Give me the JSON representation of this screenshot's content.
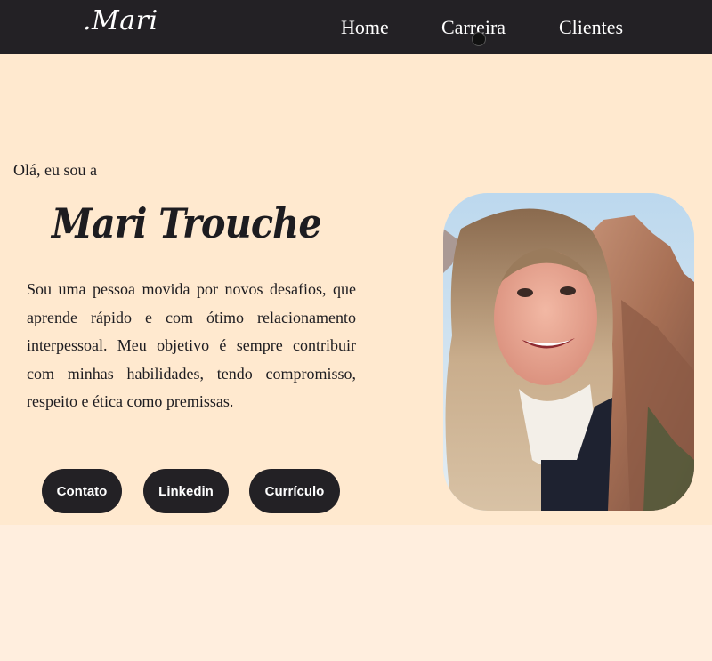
{
  "header": {
    "logo": ".Mari",
    "nav": [
      {
        "label": "Home"
      },
      {
        "label": "Carreira"
      },
      {
        "label": "Clientes"
      }
    ]
  },
  "hero": {
    "greeting": "Olá, eu sou a",
    "name": "Mari Trouche",
    "bio": "Sou uma pessoa movida por novos desafios, que aprende rápido e com ótimo relacionamento interpessoal. Meu objetivo é sempre contribuir com minhas habilidades, tendo compromisso, respeito e ética como premissas.",
    "buttons": [
      {
        "label": "Contato"
      },
      {
        "label": "Linkedin"
      },
      {
        "label": "Currículo"
      }
    ]
  },
  "colors": {
    "navbar": "#232125",
    "hero_background": "#ffe9cf",
    "button": "#232125",
    "text": "#1d1c20"
  }
}
